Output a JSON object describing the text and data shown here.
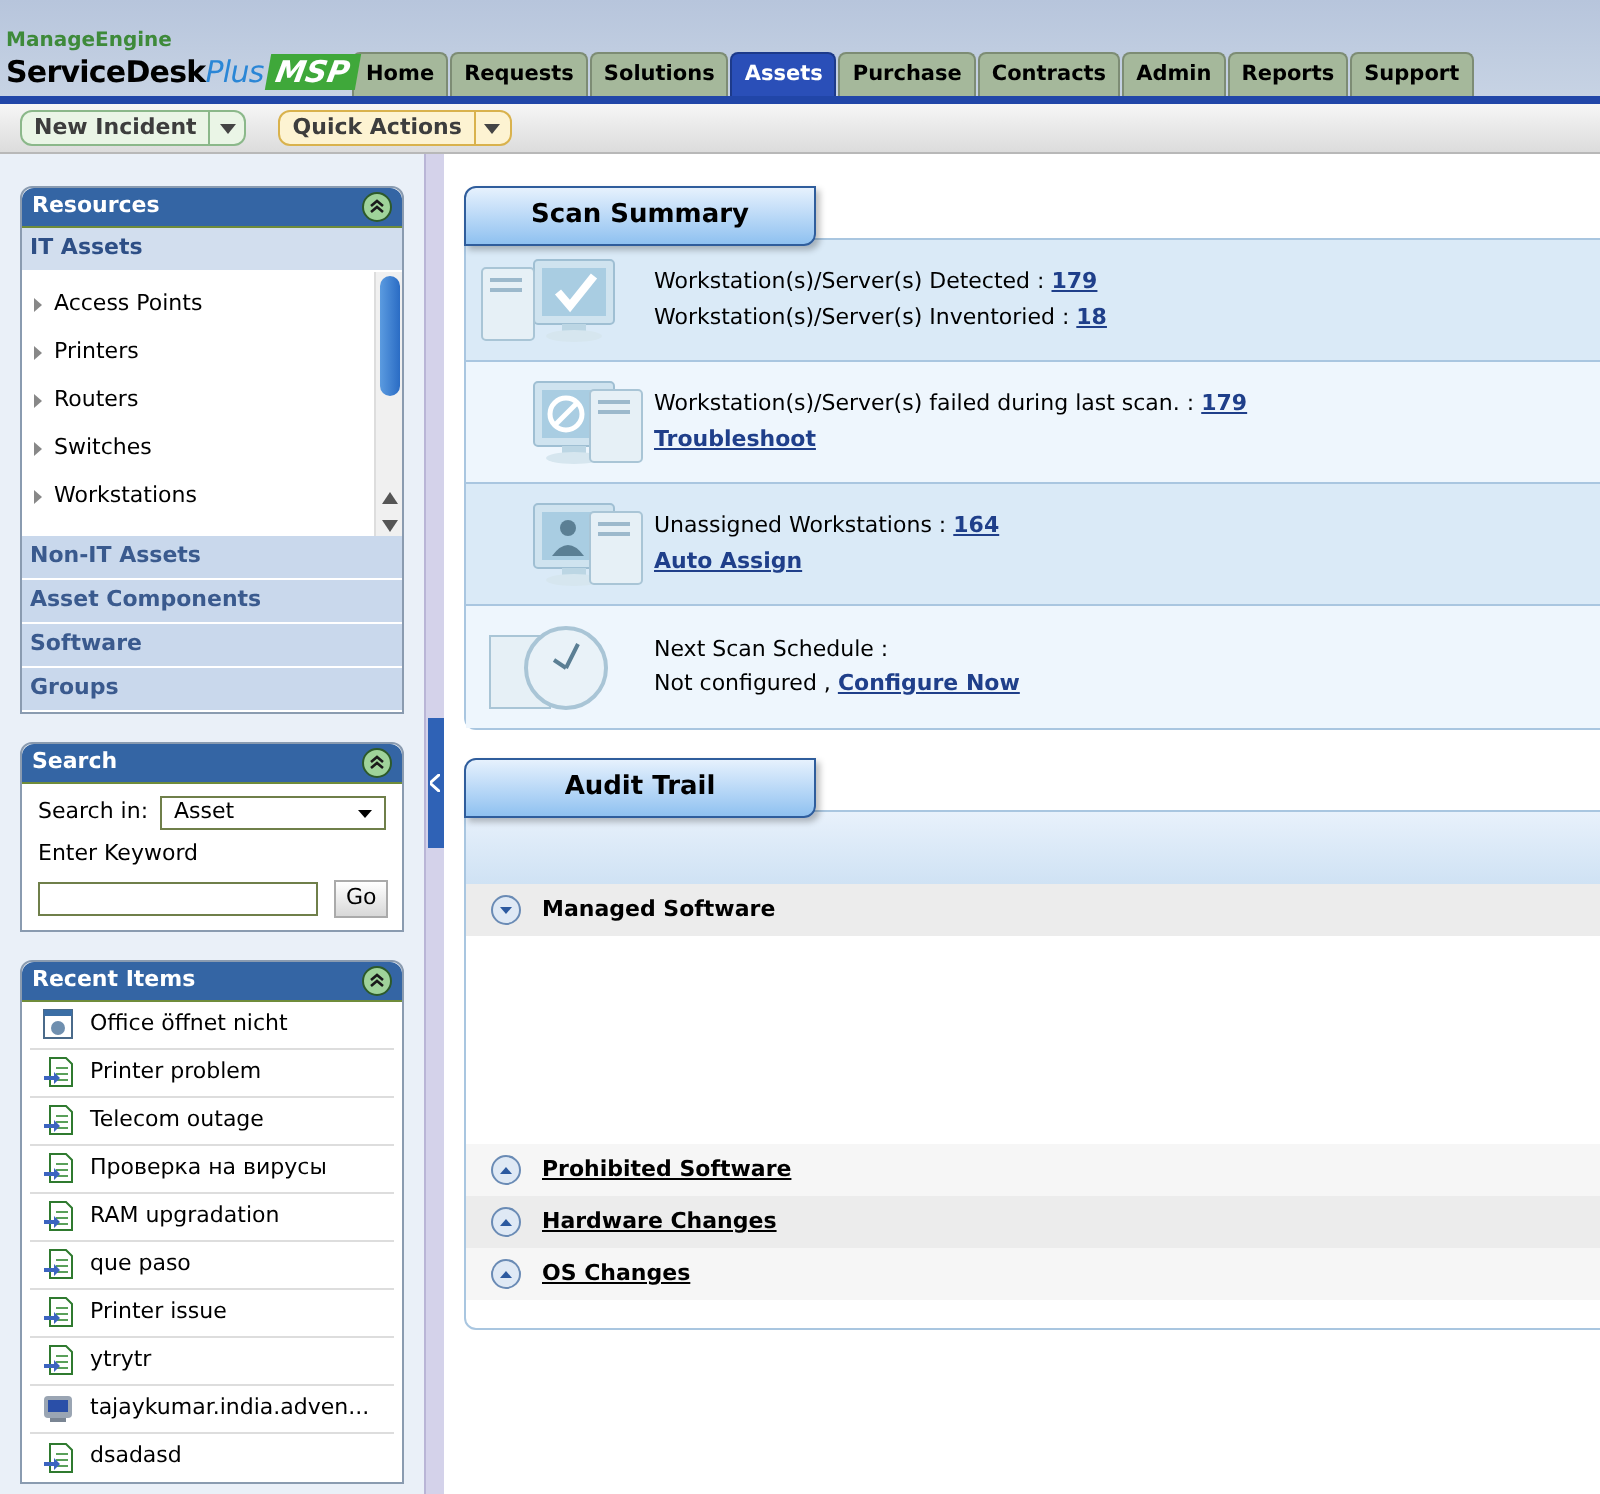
{
  "logo": {
    "company": "ManageEngine",
    "product": "ServiceDesk",
    "product_suffix": "Plus",
    "edition": "MSP"
  },
  "tabs": [
    {
      "label": "Home",
      "selected": false
    },
    {
      "label": "Requests",
      "selected": false
    },
    {
      "label": "Solutions",
      "selected": false
    },
    {
      "label": "Assets",
      "selected": true
    },
    {
      "label": "Purchase",
      "selected": false
    },
    {
      "label": "Contracts",
      "selected": false
    },
    {
      "label": "Admin",
      "selected": false
    },
    {
      "label": "Reports",
      "selected": false
    },
    {
      "label": "Support",
      "selected": false
    }
  ],
  "toolbar": [
    {
      "label": "New Incident",
      "kind": "green"
    },
    {
      "label": "Quick Actions",
      "kind": "yellow"
    }
  ],
  "resources": {
    "title": "Resources",
    "sections": [
      {
        "label": "IT Assets",
        "expanded": true,
        "items": [
          "Access Points",
          "Printers",
          "Routers",
          "Switches",
          "Workstations"
        ]
      },
      {
        "label": "Non-IT Assets",
        "expanded": false
      },
      {
        "label": "Asset Components",
        "expanded": false
      },
      {
        "label": "Software",
        "expanded": false
      },
      {
        "label": "Groups",
        "expanded": false
      }
    ]
  },
  "search": {
    "title": "Search",
    "search_in_label": "Search in:",
    "search_in_value": "Asset",
    "keyword_label": "Enter Keyword",
    "button": "Go"
  },
  "recent_items": {
    "title": "Recent Items",
    "items": [
      {
        "label": "Office öffnet nicht",
        "kind": "solution"
      },
      {
        "label": "Printer problem",
        "kind": "request"
      },
      {
        "label": "Telecom outage",
        "kind": "request"
      },
      {
        "label": "Проверка на вирусы",
        "kind": "request"
      },
      {
        "label": "RAM upgradation",
        "kind": "request"
      },
      {
        "label": "que paso",
        "kind": "request"
      },
      {
        "label": "Printer issue",
        "kind": "request"
      },
      {
        "label": "ytrytr",
        "kind": "request"
      },
      {
        "label": "tajaykumar.india.adven...",
        "kind": "asset"
      },
      {
        "label": "dsadasd",
        "kind": "request"
      }
    ]
  },
  "scan_summary": {
    "title": "Scan Summary",
    "rows": [
      {
        "kind": "detected",
        "lines": [
          {
            "text": "Workstation(s)/Server(s) Detected :",
            "link": "179"
          },
          {
            "text": "Workstation(s)/Server(s) Inventoried :",
            "link": "18"
          }
        ]
      },
      {
        "kind": "failed",
        "lines": [
          {
            "text": "Workstation(s)/Server(s) failed during last scan. :",
            "link": "179"
          },
          {
            "link": "Troubleshoot"
          }
        ]
      },
      {
        "kind": "unassigned",
        "lines": [
          {
            "text": "Unassigned Workstations :",
            "link": "164"
          },
          {
            "link": "Auto Assign"
          }
        ]
      },
      {
        "kind": "schedule",
        "lines": [
          {
            "text": "Next Scan Schedule :"
          },
          {
            "text": "Not configured ,",
            "link": "Configure Now"
          }
        ]
      }
    ]
  },
  "audit_trail": {
    "title": "Audit Trail",
    "sections": [
      {
        "label": "Managed Software",
        "expanded": true
      },
      {
        "label": "Prohibited Software",
        "expanded": false
      },
      {
        "label": "Hardware Changes",
        "expanded": false
      },
      {
        "label": "OS Changes",
        "expanded": false
      }
    ]
  }
}
